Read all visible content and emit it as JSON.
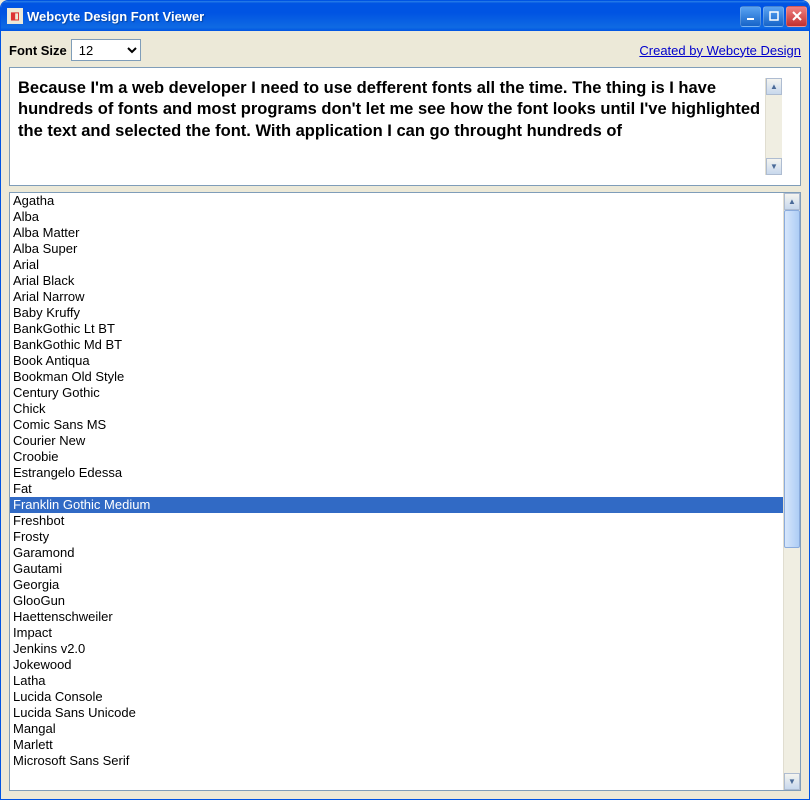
{
  "window": {
    "title": "Webcyte Design Font Viewer"
  },
  "toolbar": {
    "font_size_label": "Font Size",
    "font_size_value": "12",
    "credit_link": "Created by Webcyte Design"
  },
  "preview": {
    "text": "Because I'm a web developer I need to use defferent fonts all the time. The thing is I have hundreds of fonts and most programs don't let me see how the font looks until I've highlighted the text and selected the font. With application I can go throught hundreds of"
  },
  "fonts": {
    "selected_index": 19,
    "items": [
      "Agatha",
      "Alba",
      "Alba Matter",
      "Alba Super",
      "Arial",
      "Arial Black",
      "Arial Narrow",
      "Baby Kruffy",
      "BankGothic Lt BT",
      "BankGothic Md BT",
      "Book Antiqua",
      "Bookman Old Style",
      "Century Gothic",
      "Chick",
      "Comic Sans MS",
      "Courier New",
      "Croobie",
      "Estrangelo Edessa",
      "Fat",
      "Franklin Gothic Medium",
      "Freshbot",
      "Frosty",
      "Garamond",
      "Gautami",
      "Georgia",
      "GlooGun",
      "Haettenschweiler",
      "Impact",
      "Jenkins v2.0",
      "Jokewood",
      "Latha",
      "Lucida Console",
      "Lucida Sans Unicode",
      "Mangal",
      "Marlett",
      "Microsoft Sans Serif"
    ]
  }
}
